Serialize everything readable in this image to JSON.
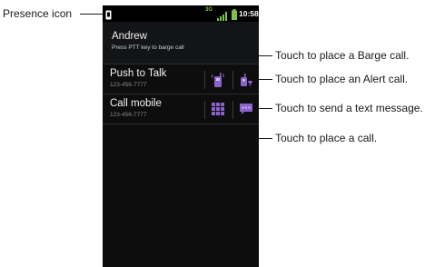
{
  "callouts": {
    "presence": "Presence icon",
    "barge": "Touch to place a Barge call.",
    "alert": "Touch to place an Alert call.",
    "text": "Touch to send a text message.",
    "call": "Touch to place a call."
  },
  "status_bar": {
    "network": "3G",
    "time": "10:58"
  },
  "contact": {
    "name": "Andrew",
    "subtitle": "Press PTT key to barge call"
  },
  "rows": [
    {
      "title": "Push to Talk",
      "number": "123-456-7777",
      "actions": [
        "barge-call-icon",
        "alert-call-icon"
      ]
    },
    {
      "title": "Call mobile",
      "number": "123-456-7777",
      "actions": [
        "dialpad-icon",
        "text-message-icon"
      ]
    }
  ],
  "colors": {
    "background": "#0d0d0e",
    "icon_purple": "#8a63c9",
    "signal_green": "#7dc24a"
  }
}
